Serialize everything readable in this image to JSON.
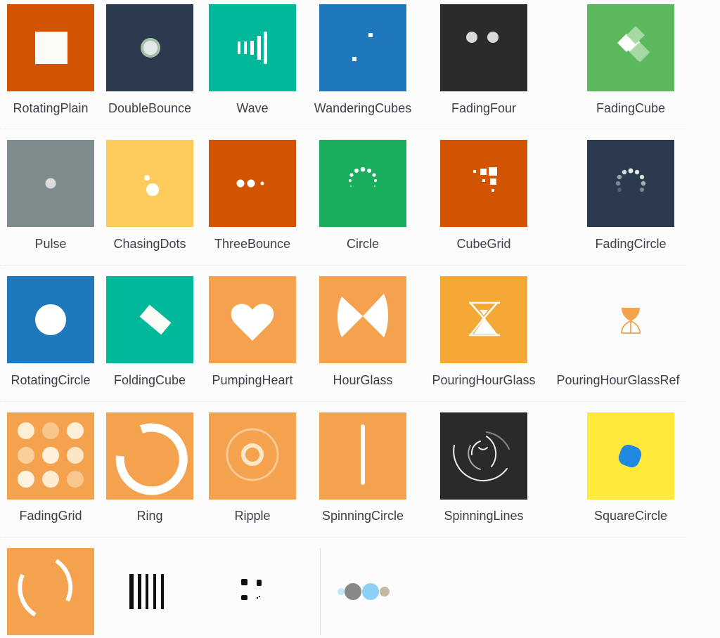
{
  "rows": [
    {
      "items": [
        {
          "name": "RotatingPlain",
          "color": "#d35400"
        },
        {
          "name": "DoubleBounce",
          "color": "#2c3a4f"
        },
        {
          "name": "Wave",
          "color": "#02b89b"
        },
        {
          "name": "WanderingCubes",
          "color": "#1f78bb"
        },
        {
          "name": "FadingFour",
          "color": "#2b2b2b"
        },
        {
          "name": "FadingCube",
          "color": "#5cb85c"
        }
      ]
    },
    {
      "items": [
        {
          "name": "Pulse",
          "color": "#7f8c8d"
        },
        {
          "name": "ChasingDots",
          "color": "#fdcb5c"
        },
        {
          "name": "ThreeBounce",
          "color": "#d35400"
        },
        {
          "name": "Circle",
          "color": "#1bae5f"
        },
        {
          "name": "CubeGrid",
          "color": "#d35400"
        },
        {
          "name": "FadingCircle",
          "color": "#2c3a4f"
        }
      ]
    },
    {
      "items": [
        {
          "name": "RotatingCircle",
          "color": "#1f78bb"
        },
        {
          "name": "FoldingCube",
          "color": "#02b89b"
        },
        {
          "name": "PumpingHeart",
          "color": "#f4a24d"
        },
        {
          "name": "HourGlass",
          "color": "#f4a24d"
        },
        {
          "name": "PouringHourGlass",
          "color": "#f4a835"
        },
        {
          "name": "PouringHourGlassRef",
          "color": "#f4a24d"
        }
      ]
    },
    {
      "items": [
        {
          "name": "FadingGrid",
          "color": "#f4a24d"
        },
        {
          "name": "Ring",
          "color": "#f4a24d"
        },
        {
          "name": "Ripple",
          "color": "#f4a24d"
        },
        {
          "name": "SpinningCircle",
          "color": "#f4a24d"
        },
        {
          "name": "SpinningLines",
          "color": "#2a2a2a"
        },
        {
          "name": "SquareCircle",
          "color": "#ffe93b"
        }
      ]
    },
    {
      "items": [
        {
          "name": "",
          "color": "#f4a24d"
        },
        {
          "name": "",
          "color": "#111111"
        },
        {
          "name": "",
          "color": "#111111"
        },
        {
          "name": "",
          "color": "#888888"
        }
      ]
    }
  ]
}
